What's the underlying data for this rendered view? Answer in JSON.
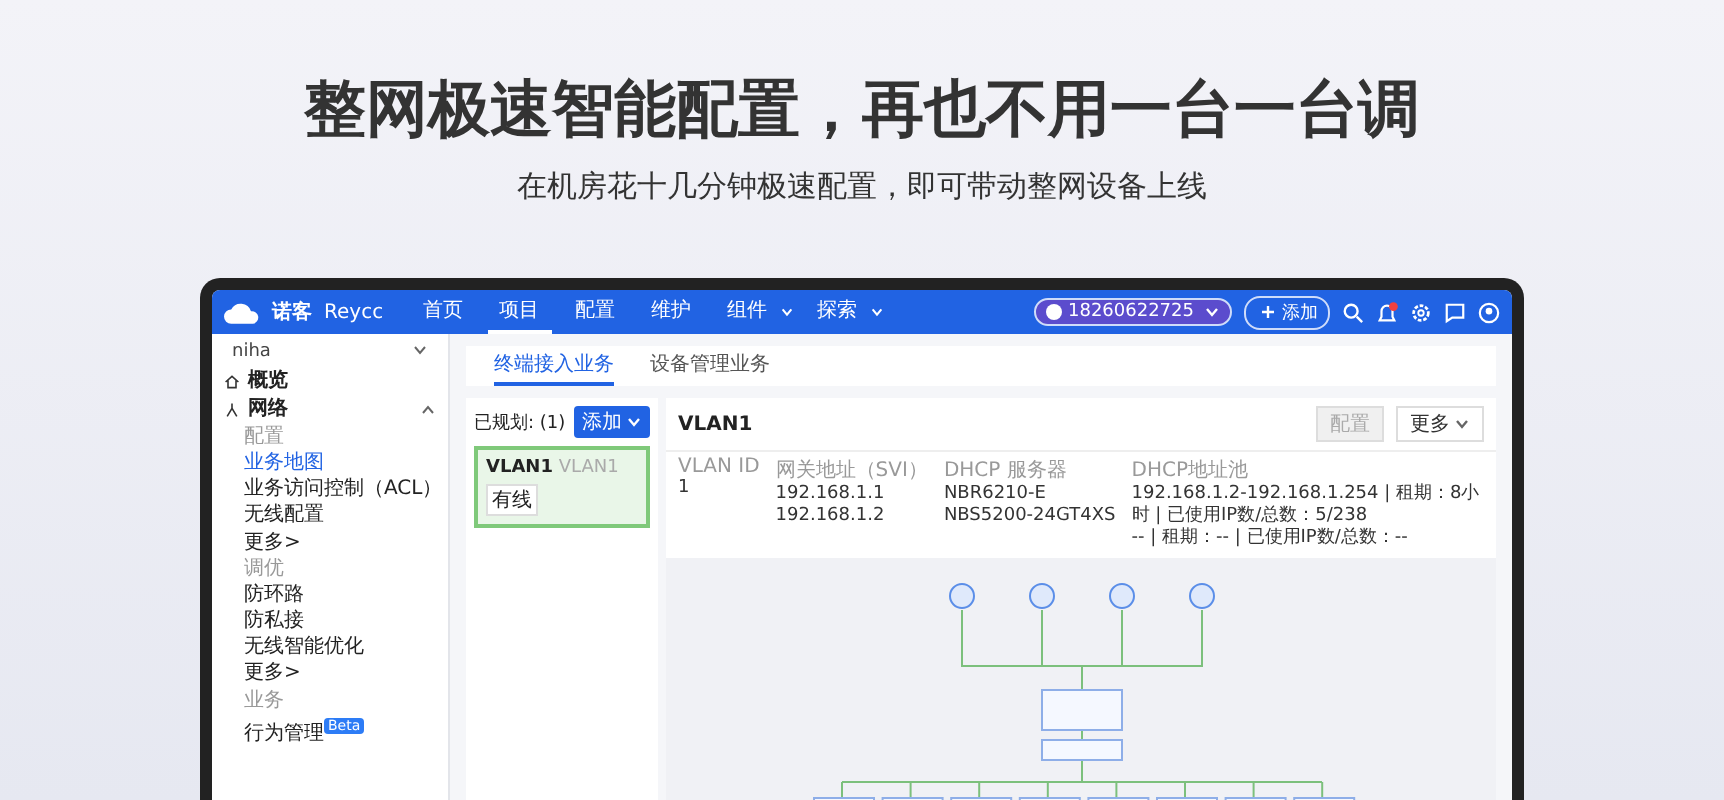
{
  "headline": "整网极速智能配置，再也不用一台一台调",
  "subheadline": "在机房花十几分钟极速配置，即可带动整网设备上线",
  "app": {
    "brand": {
      "name": "诺客",
      "sub": "Reycc"
    },
    "nav": [
      {
        "label": "首页",
        "dropdown": false,
        "selected": false
      },
      {
        "label": "项目",
        "dropdown": false,
        "selected": true
      },
      {
        "label": "配置",
        "dropdown": false,
        "selected": false
      },
      {
        "label": "维护",
        "dropdown": false,
        "selected": false
      },
      {
        "label": "组件",
        "dropdown": true,
        "selected": false
      },
      {
        "label": "探索",
        "dropdown": true,
        "selected": false
      }
    ],
    "account": "18260622725",
    "add_button": "添加",
    "notifications": {
      "unread": true
    },
    "sidebar": {
      "project": "niha",
      "items": [
        {
          "label": "概览"
        },
        {
          "label": "网络",
          "expanded": true,
          "groups": [
            {
              "heading": "配置",
              "items": [
                {
                  "label": "业务地图",
                  "selected": true
                },
                {
                  "label": "业务访问控制（ACL）",
                  "selected": false
                },
                {
                  "label": "无线配置",
                  "selected": false
                },
                {
                  "label": "更多>",
                  "selected": false
                }
              ]
            },
            {
              "heading": "调优",
              "items": [
                {
                  "label": "防环路",
                  "selected": false
                },
                {
                  "label": "防私接",
                  "selected": false
                },
                {
                  "label": "无线智能优化",
                  "selected": false
                },
                {
                  "label": "更多>",
                  "selected": false
                }
              ]
            },
            {
              "heading": "业务",
              "items": [
                {
                  "label": "行为管理",
                  "selected": false,
                  "badge": "Beta"
                }
              ]
            }
          ]
        }
      ]
    },
    "tabs": [
      {
        "label": "终端接入业务",
        "selected": true
      },
      {
        "label": "设备管理业务",
        "selected": false
      }
    ],
    "vlan_panel": {
      "label": "已规划:",
      "count": "(1)",
      "add_button": "添加",
      "cards": [
        {
          "name": "VLAN1",
          "alias": "VLAN1",
          "tag": "有线",
          "selected": true
        }
      ]
    },
    "detail": {
      "title": "VLAN1",
      "buttons": [
        {
          "label": "配置",
          "disabled": true,
          "dropdown": false
        },
        {
          "label": "更多",
          "disabled": false,
          "dropdown": true
        }
      ],
      "columns": [
        {
          "heading": "VLAN ID",
          "lines": [
            "1"
          ]
        },
        {
          "heading": "网关地址（SVI）",
          "lines": [
            "192.168.1.1",
            "192.168.1.2"
          ]
        },
        {
          "heading": "DHCP 服务器",
          "lines": [
            "NBR6210-E",
            "NBS5200-24GT4XS"
          ]
        },
        {
          "heading": "DHCP地址池",
          "lines": [
            "192.168.1.2-192.168.1.254 | 租期：8小时 | 已使用IP数/总数：5/238",
            "-- | 租期：-- | 已使用IP数/总数：--"
          ]
        }
      ]
    }
  }
}
